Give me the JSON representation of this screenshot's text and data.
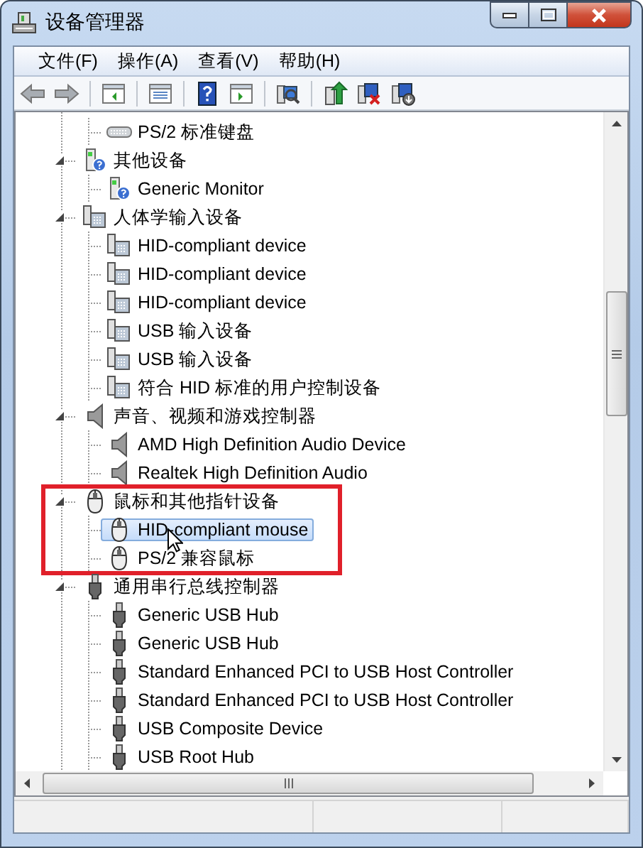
{
  "window": {
    "title": "设备管理器"
  },
  "menu": [
    "文件(F)",
    "操作(A)",
    "查看(V)",
    "帮助(H)"
  ],
  "tree": {
    "continued_children": [
      {
        "label": "PS/2 标准键盘",
        "kind": "keyboard",
        "selected": false
      }
    ],
    "categories": [
      {
        "label": "其他设备",
        "kind": "unknown",
        "expanded": true,
        "highlighted": false,
        "children": [
          {
            "label": "Generic Monitor",
            "kind": "unknown",
            "selected": false
          }
        ]
      },
      {
        "label": "人体学输入设备",
        "kind": "hid",
        "expanded": true,
        "highlighted": false,
        "children": [
          {
            "label": "HID-compliant device",
            "kind": "hid",
            "selected": false
          },
          {
            "label": "HID-compliant device",
            "kind": "hid",
            "selected": false
          },
          {
            "label": "HID-compliant device",
            "kind": "hid",
            "selected": false
          },
          {
            "label": "USB 输入设备",
            "kind": "hid",
            "selected": false
          },
          {
            "label": "USB 输入设备",
            "kind": "hid",
            "selected": false
          },
          {
            "label": "符合 HID 标准的用户控制设备",
            "kind": "hid",
            "selected": false
          }
        ]
      },
      {
        "label": "声音、视频和游戏控制器",
        "kind": "audio",
        "expanded": true,
        "highlighted": false,
        "children": [
          {
            "label": "AMD High Definition Audio Device",
            "kind": "audio",
            "selected": false
          },
          {
            "label": "Realtek High Definition Audio",
            "kind": "audio",
            "selected": false
          }
        ]
      },
      {
        "label": "鼠标和其他指针设备",
        "kind": "mouse",
        "expanded": true,
        "highlighted": true,
        "children": [
          {
            "label": "HID-compliant mouse",
            "kind": "mouse",
            "selected": true
          },
          {
            "label": "PS/2 兼容鼠标",
            "kind": "mouse",
            "selected": false
          }
        ]
      },
      {
        "label": "通用串行总线控制器",
        "kind": "usb",
        "expanded": true,
        "highlighted": false,
        "children": [
          {
            "label": "Generic USB Hub",
            "kind": "usb",
            "selected": false
          },
          {
            "label": "Generic USB Hub",
            "kind": "usb",
            "selected": false
          },
          {
            "label": "Standard Enhanced PCI to USB Host Controller",
            "kind": "usb",
            "selected": false
          },
          {
            "label": "Standard Enhanced PCI to USB Host Controller",
            "kind": "usb",
            "selected": false
          },
          {
            "label": "USB Composite Device",
            "kind": "usb",
            "selected": false
          },
          {
            "label": "USB Root Hub",
            "kind": "usb",
            "selected": false
          }
        ]
      }
    ]
  }
}
